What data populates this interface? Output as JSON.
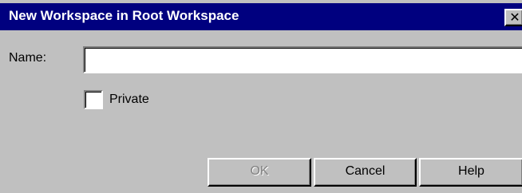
{
  "window": {
    "title": "New Workspace in Root Workspace",
    "close_glyph": "✕"
  },
  "form": {
    "name_label": "Name:",
    "name_value": "",
    "private_label": "Private",
    "private_checked": false
  },
  "buttons": {
    "ok_label": "OK",
    "ok_enabled": false,
    "cancel_label": "Cancel",
    "help_label": "Help"
  },
  "colors": {
    "titlebar": "#00007f",
    "dialog_face": "#c0c0c0",
    "field_bg": "#ffffff",
    "disabled_text": "#808080"
  },
  "icons": {
    "close": "close-icon"
  }
}
